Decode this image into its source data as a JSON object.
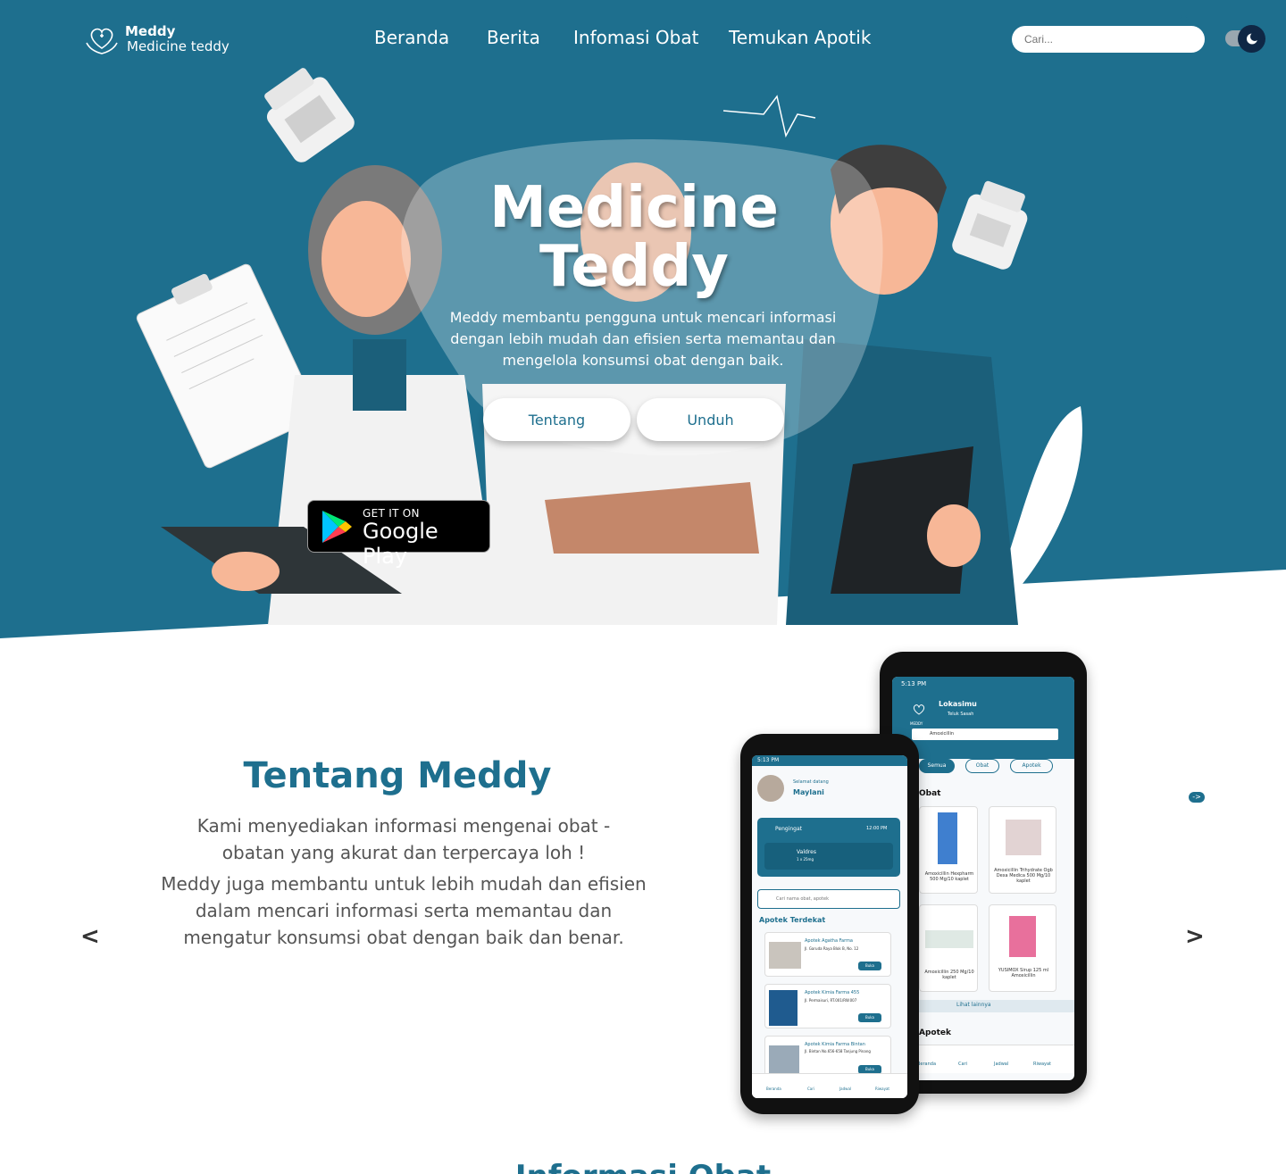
{
  "brand": {
    "name": "Meddy",
    "tagline": "Medicine teddy"
  },
  "nav": {
    "items": [
      "Beranda",
      "Berita",
      "Infomasi Obat",
      "Temukan Apotik"
    ]
  },
  "search": {
    "placeholder": "Cari..."
  },
  "hero": {
    "title_line1": "Medicine",
    "title_line2": "Teddy",
    "description_line1": "Meddy membantu pengguna untuk mencari informasi",
    "description_line2": "dengan lebih mudah dan efisien serta memantau dan",
    "description_line3": "mengelola konsumsi obat dengan baik.",
    "button_about": "Tentang",
    "button_download": "Unduh",
    "store_small": "GET IT ON",
    "store_big": "Google Play"
  },
  "about": {
    "title": "Tentang Meddy",
    "line1": "Kami menyediakan informasi mengenai obat -",
    "line2": "obatan yang akurat dan terpercaya loh !",
    "line3": "Meddy juga membantu untuk lebih mudah dan efisien",
    "line4": "dalam mencari informasi serta memantau dan",
    "line5": "mengatur konsumsi obat dengan baik dan benar.",
    "prev": "<",
    "next": ">",
    "mini_next": "->"
  },
  "next_section": {
    "title": "Informasi Obat"
  },
  "phone_front": {
    "time": "5:13 PM",
    "greeting": "Selamat datang",
    "user": "Maylani",
    "reminder_label": "Pengingat",
    "reminder_time": "12:00 PM",
    "reminder_drug": "Valdres",
    "reminder_dose": "1 x 25mg",
    "search_placeholder": "Cari nama obat, apotek",
    "nearby_title": "Apotek Terdekat",
    "pharmacies": [
      {
        "name": "Apotek Agatha Farma",
        "address": "Jl. Garuda Raya Blok B, No. 12",
        "status": "Buka"
      },
      {
        "name": "Apotek Kimia Farma 455",
        "address": "Jl. Permaisuri, RT.001/RW.007",
        "status": "Buka"
      },
      {
        "name": "Apotek Kimia Farma Bintan",
        "address": "Jl. Bintan No.656-658 Tanjung Pinang",
        "status": "Buka"
      }
    ],
    "tabs": [
      "Beranda",
      "Cari",
      "Jadwal",
      "Riwayat"
    ]
  },
  "phone_back": {
    "time": "5:13 PM",
    "location_label": "Lokasimu",
    "location": "Teluk Sasah",
    "search_value": "Amoxicillin",
    "logo_text": "MEDDY",
    "filters": [
      "Semua",
      "Obat",
      "Apotek"
    ],
    "section_drugs": "Obat",
    "drugs": [
      "Amoxicillin Hexpharm 500 Mg/10 kaplet",
      "Amoxicillin Trihydrate Ogb Dexa Medica 500 Mg/10 kaplet",
      "Amoxicillin 250 Mg/10 kaplet",
      "YUSIMOX Sirup 125 ml Amoxicillin"
    ],
    "see_more": "Lihat lainnya",
    "section_pharmacy": "Apotek",
    "tabs": [
      "Beranda",
      "Cari",
      "Jadwal",
      "Riwayat"
    ]
  },
  "colors": {
    "primary": "#1e6f8e",
    "dark": "#0f2745",
    "white": "#ffffff"
  }
}
